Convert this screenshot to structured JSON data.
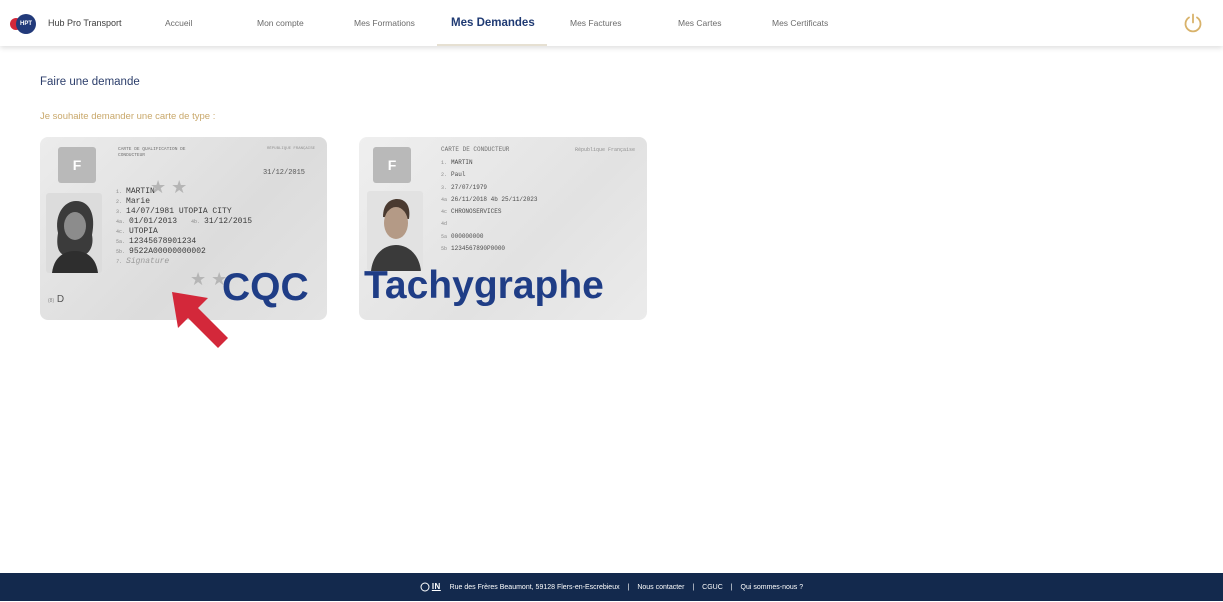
{
  "nav": {
    "brand": "Hub Pro Transport",
    "logo_text": "HPT",
    "items": [
      {
        "label": "Accueil"
      },
      {
        "label": "Mon compte"
      },
      {
        "label": "Mes Formations"
      },
      {
        "label": "Mes Demandes"
      },
      {
        "label": "Mes Factures"
      },
      {
        "label": "Mes Cartes"
      },
      {
        "label": "Mes Certificats"
      }
    ],
    "active_item": "Mes Demandes",
    "power_icon": "power-icon"
  },
  "main": {
    "title": "Faire une demande",
    "subtitle": "Je souhaite demander une carte de type :"
  },
  "cards": {
    "cqc": {
      "label": "CQC",
      "flag": "F",
      "header": "CARTE DE QUALIFICATION DE CONDUCTEUR",
      "country": "RÉPUBLIQUE FRANÇAISE",
      "date": "31/12/2015",
      "lines": [
        {
          "k": "1.",
          "v": "MARTIN"
        },
        {
          "k": "2.",
          "v": "Marie"
        },
        {
          "k": "3.",
          "v": "14/07/1981 UTOPIA CITY"
        },
        {
          "k": "4a.",
          "v": "01/01/2013"
        },
        {
          "k": "4b.",
          "v": "31/12/2015"
        },
        {
          "k": "4c.",
          "v": "UTOPIA"
        },
        {
          "k": "5a.",
          "v": "12345678901234"
        },
        {
          "k": "5b.",
          "v": "9522A00000000002"
        },
        {
          "k": "7.",
          "v": "Signature"
        }
      ],
      "footer_code": "D",
      "footer_key": "(8)"
    },
    "tachy": {
      "label": "Tachygraphe",
      "flag": "F",
      "header": "CARTE DE CONDUCTEUR",
      "country": "République Française",
      "lines": [
        {
          "k": "1.",
          "v": "MARTIN"
        },
        {
          "k": "2.",
          "v": "Paul"
        },
        {
          "k": "3.",
          "v": "27/07/1979"
        },
        {
          "k": "4a",
          "v": "26/11/2018   4b 25/11/2023"
        },
        {
          "k": "4c",
          "v": "CHRONOSERVICES"
        },
        {
          "k": "4d",
          "v": ""
        },
        {
          "k": "5a",
          "v": "000000000"
        },
        {
          "k": "5b",
          "v": "1234567890P0000"
        }
      ]
    }
  },
  "footer": {
    "logo": "IN",
    "address": "Rue des Frères Beaumont, 59128 Flers-en-Escrebieux",
    "links": [
      "Nous contacter",
      "CGUC",
      "Qui sommes-nous ?"
    ],
    "separator": "|"
  },
  "colors": {
    "primary": "#1f3a73",
    "accent_gold": "#c9a86b",
    "footer_bg": "#13294d",
    "arrow": "#d3283a",
    "label_blue": "#1f3d86",
    "power": "#d8b26a"
  }
}
